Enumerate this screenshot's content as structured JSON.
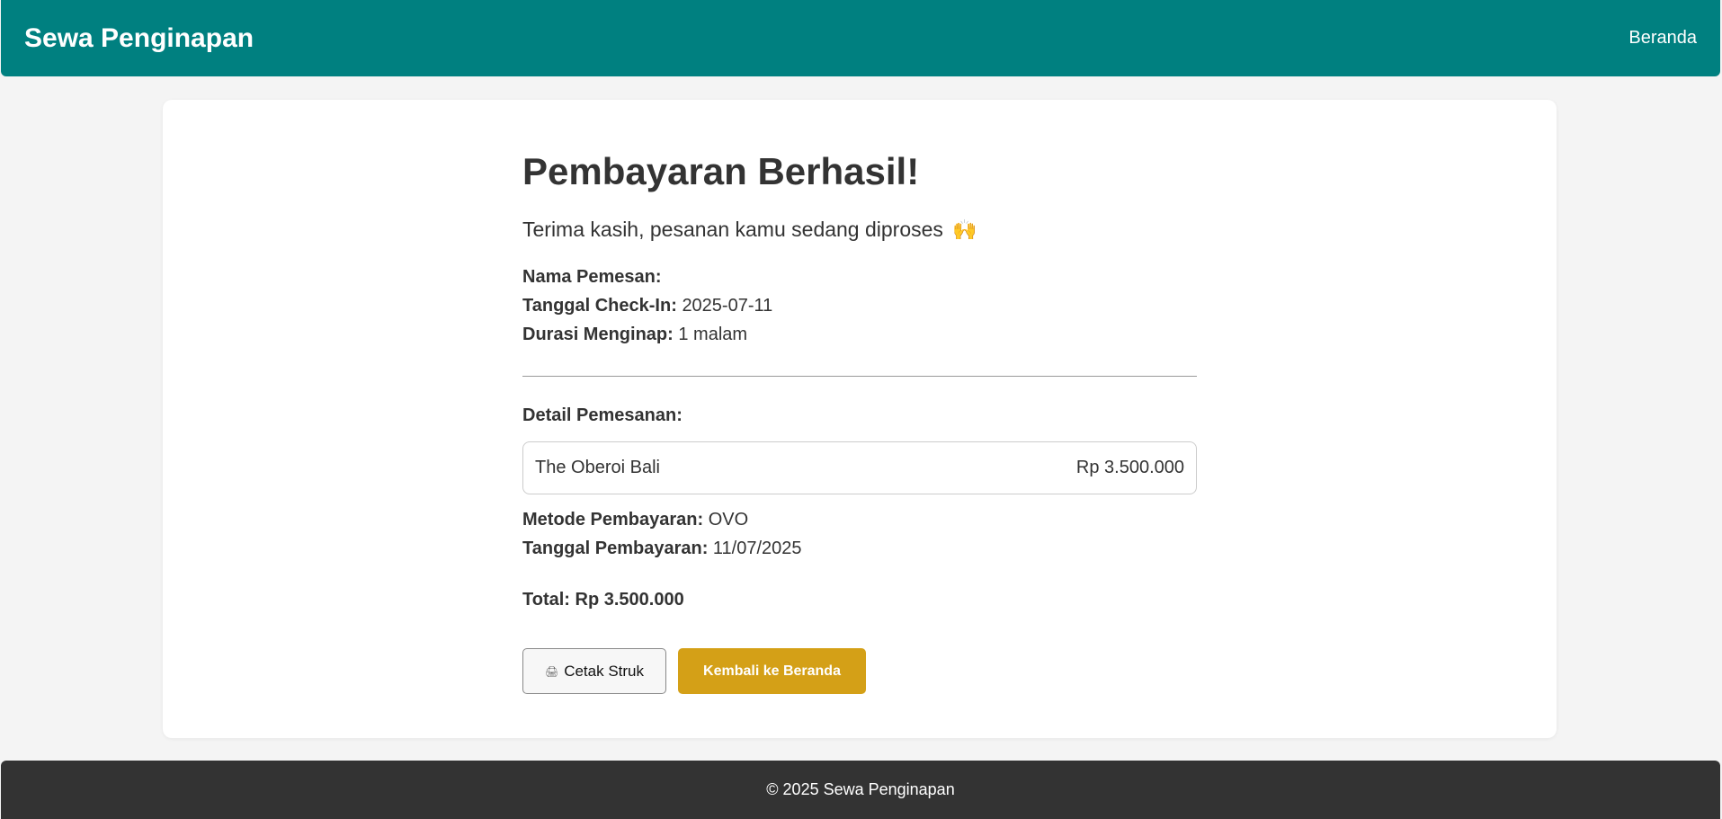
{
  "header": {
    "brand": "Sewa Penginapan",
    "nav_home": "Beranda"
  },
  "main": {
    "title": "Pembayaran Berhasil!",
    "subtitle": "Terima kasih, pesanan kamu sedang diproses",
    "subtitle_emoji": "🙌",
    "booker_label": "Nama Pemesan:",
    "booker_value": "",
    "checkin_label": "Tanggal Check-In:",
    "checkin_value": "2025-07-11",
    "duration_label": "Durasi Menginap:",
    "duration_value": "1 malam",
    "detail_label": "Detail Pemesanan:",
    "item": {
      "name": "The Oberoi Bali",
      "price": "Rp 3.500.000"
    },
    "method_label": "Metode Pembayaran:",
    "method_value": "OVO",
    "paydate_label": "Tanggal Pembayaran:",
    "paydate_value": "11/07/2025",
    "total_label": "Total:",
    "total_value": "Rp 3.500.000",
    "print_icon": "🖨",
    "print_label": "Cetak Struk",
    "home_button": "Kembali ke Beranda"
  },
  "footer": {
    "text": "© 2025 Sewa Penginapan"
  },
  "colors": {
    "header": "#008080",
    "accent_button": "#d4a017",
    "footer": "#333333",
    "background": "#f4f4f4"
  }
}
